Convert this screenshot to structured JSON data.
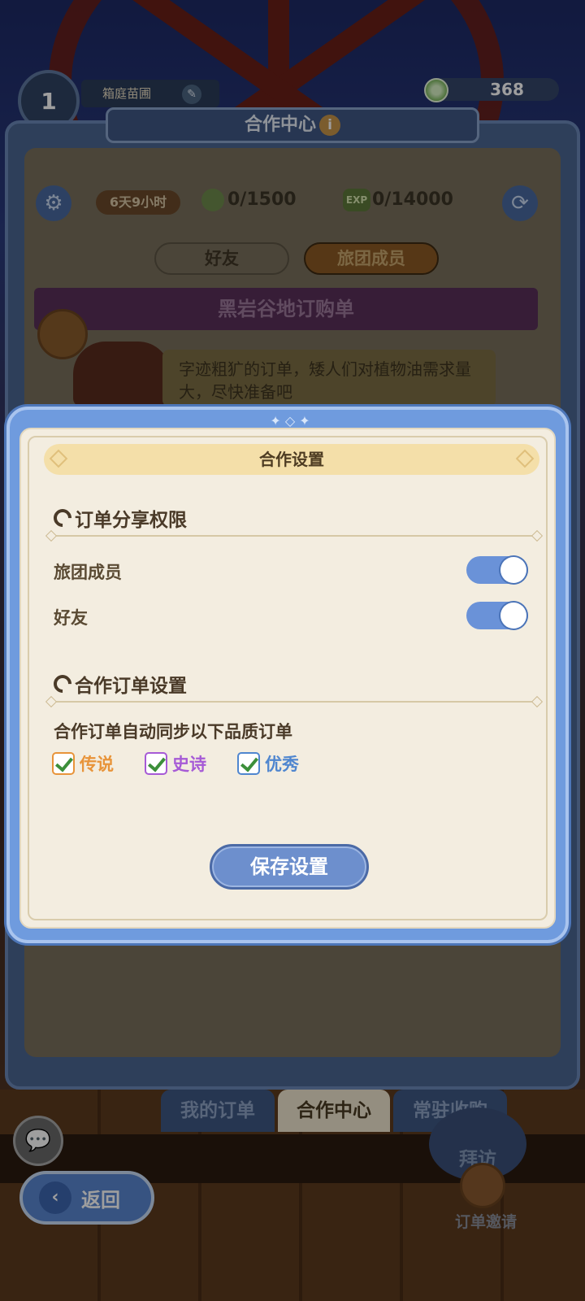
{
  "hud": {
    "level": "1",
    "player_name": "箱庭苗圃",
    "currency_amount": "368"
  },
  "background_panel": {
    "title": "合作中心",
    "timer": "6天9小时",
    "coin_progress": "0/1500",
    "exp_badge": "EXP",
    "exp_progress": "0/14000",
    "tabs": [
      "好友",
      "旅团成员"
    ],
    "order_title": "黑岩谷地订购单",
    "order_description": "字迹粗犷的订单，矮人们对植物油需求量大，尽快准备吧"
  },
  "bottom_nav": {
    "tabs": [
      "我的订单",
      "合作中心",
      "常驻收购"
    ],
    "visit_label": "拜访",
    "invite_label": "订单邀请",
    "back_label": "返回"
  },
  "modal": {
    "title": "合作设置",
    "section1": {
      "heading": "订单分享权限",
      "toggles": [
        {
          "label": "旅团成员",
          "on": true
        },
        {
          "label": "好友",
          "on": true
        }
      ]
    },
    "section2": {
      "heading": "合作订单设置",
      "description": "合作订单自动同步以下品质订单",
      "qualities": [
        {
          "label": "传说",
          "checked": true,
          "color": "#e8943a"
        },
        {
          "label": "史诗",
          "checked": true,
          "color": "#a65ad6"
        },
        {
          "label": "优秀",
          "checked": true,
          "color": "#4f86cf"
        }
      ]
    },
    "save_label": "保存设置"
  },
  "colors": {
    "modal_frame": "#6f9bde",
    "modal_bg": "#f3ede0",
    "toggle_on": "#6a92d8",
    "title_bar": "#f4dfa9"
  }
}
